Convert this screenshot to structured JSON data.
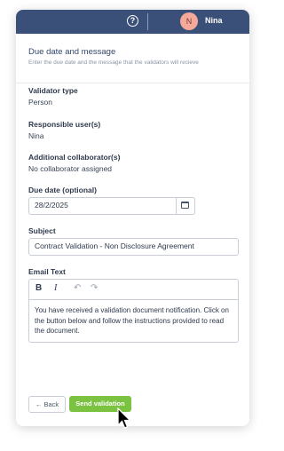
{
  "header": {
    "help_icon": "question-circle-icon",
    "avatar_initial": "N",
    "user_name": "Nina",
    "avatar_color": "#f4a99a",
    "bar_color": "#3b5078"
  },
  "section": {
    "title": "Due date and message",
    "subtitle": "Enter the due date and the message that the validators will recieve"
  },
  "fields": {
    "validator_type_label": "Validator type",
    "validator_type_value": "Person",
    "responsible_label": "Responsible user(s)",
    "responsible_value": "Nina",
    "collaborators_label": "Additional collaborator(s)",
    "collaborators_value": "No collaborator assigned",
    "due_date_label": "Due date (optional)",
    "due_date_value": "28/2/2025",
    "subject_label": "Subject",
    "subject_value": "Contract Validation - Non Disclosure Agreement",
    "email_label": "Email Text",
    "email_body": "You have received a validation document notification. Click on the button below and follow the instructions provided to read the document."
  },
  "toolbar": {
    "bold": "B",
    "italic": "I",
    "undo": "↶",
    "redo": "↷"
  },
  "actions": {
    "back_label": "← Back",
    "send_label": "Send validation",
    "send_color": "#7cc241"
  }
}
